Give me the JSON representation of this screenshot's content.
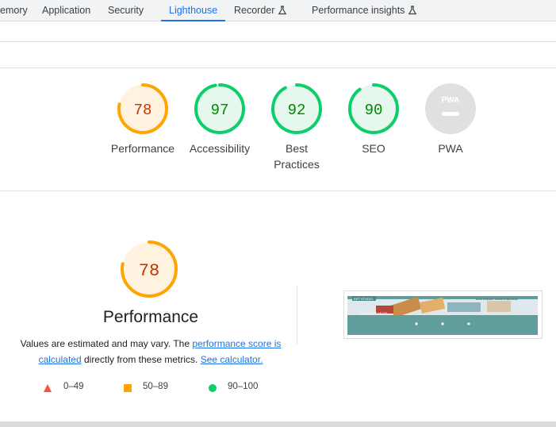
{
  "tabs": [
    {
      "label": "emory",
      "active": false,
      "experimental": false
    },
    {
      "label": "Application",
      "active": false,
      "experimental": false
    },
    {
      "label": "Security",
      "active": false,
      "experimental": false
    },
    {
      "label": "Lighthouse",
      "active": true,
      "experimental": false
    },
    {
      "label": "Recorder",
      "active": false,
      "experimental": true
    },
    {
      "label": "Performance insights",
      "active": false,
      "experimental": true
    }
  ],
  "colors": {
    "accent": "#1a73e8",
    "pass": "#0cce6b",
    "average": "#ffa400",
    "fail": "#ff4e42",
    "average_text": "#c33300",
    "pass_text": "#008800",
    "pwa_gray": "#e0e0e0"
  },
  "scores": [
    {
      "label": "Performance",
      "value": "78",
      "fraction": 0.78,
      "rating": "average"
    },
    {
      "label": "Accessibility",
      "value": "97",
      "fraction": 0.97,
      "rating": "pass"
    },
    {
      "label": "Best Practices",
      "value": "92",
      "fraction": 0.92,
      "rating": "pass"
    },
    {
      "label": "SEO",
      "value": "90",
      "fraction": 0.9,
      "rating": "pass"
    },
    {
      "label": "PWA",
      "value": "",
      "rating": "pwa",
      "badge_text": "PWA"
    }
  ],
  "performance": {
    "score": "78",
    "fraction": 0.78,
    "title": "Performance",
    "desc_prefix": "Values are estimated and may vary. The ",
    "link_score": "performance score is calculated",
    "desc_middle": " directly from these metrics. ",
    "link_calculator": "See calculator."
  },
  "legend": [
    {
      "range": "0–49",
      "shape": "triangle-icon"
    },
    {
      "range": "50–89",
      "shape": "square-icon"
    },
    {
      "range": "90–100",
      "shape": "circle-icon"
    }
  ],
  "thumbnail": {
    "banner_tag": "ART STUDIO",
    "nav_text": "Home  Inspiration  Tutorial  Contact  About",
    "hero_text": "FIND YOUR MUSE"
  }
}
